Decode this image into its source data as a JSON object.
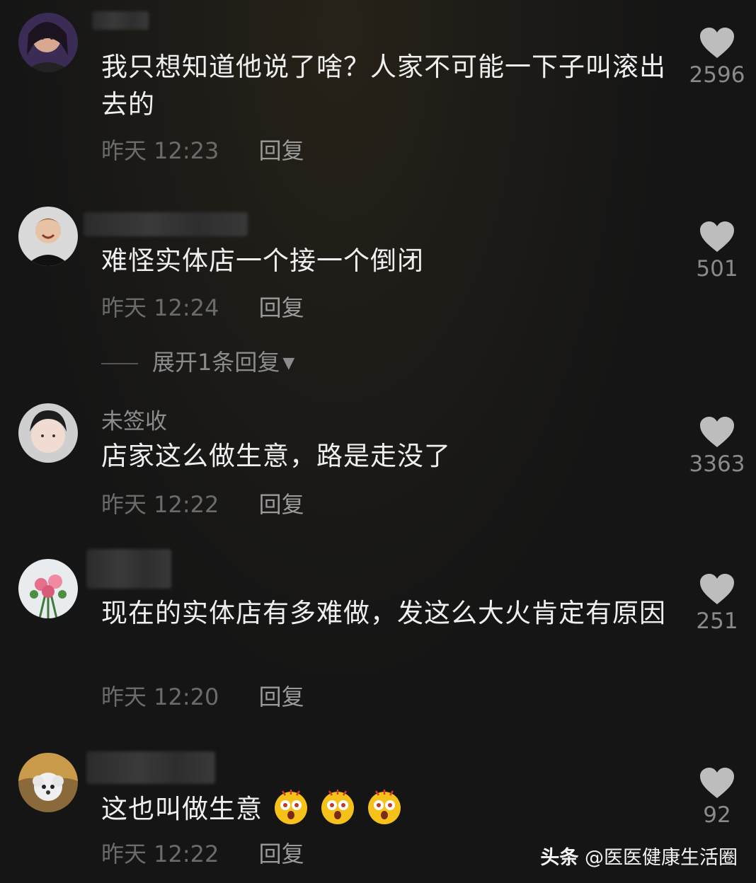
{
  "comments": [
    {
      "username": "",
      "text": "我只想知道他说了啥？人家不可能一下子叫滚出去的",
      "time": "昨天 12:23",
      "reply_label": "回复",
      "likes": "2596"
    },
    {
      "username": "",
      "text": "难怪实体店一个接一个倒闭",
      "time": "昨天 12:24",
      "reply_label": "回复",
      "likes": "501"
    },
    {
      "username": "未签收",
      "text": "店家这么做生意，路是走没了",
      "time": "昨天 12:22",
      "reply_label": "回复",
      "likes": "3363"
    },
    {
      "username": "",
      "text": "现在的实体店有多难做，发这么大火肯定有原因",
      "time": "昨天 12:20",
      "reply_label": "回复",
      "likes": "251"
    },
    {
      "username": "",
      "text": "这也叫做生意",
      "time": "昨天 12:22",
      "reply_label": "回复",
      "likes": "92",
      "emojis": [
        "shocked-face-icon",
        "shocked-face-icon",
        "shocked-face-icon"
      ]
    }
  ],
  "expand_replies": "展开1条回复",
  "watermark": {
    "brand": "头条",
    "account": "@医医健康生活圈"
  },
  "colors": {
    "background": "#151515",
    "text": "#efefef",
    "muted": "#6b6b6b",
    "emoji": "#f6c21a"
  }
}
